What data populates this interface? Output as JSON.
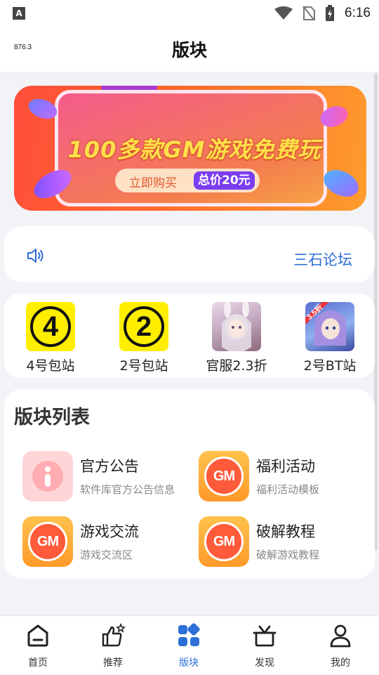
{
  "status_bar": {
    "time": "6:16",
    "left_icon": "A"
  },
  "header": {
    "speed": "876.3",
    "title": "版块"
  },
  "banner": {
    "headline": "100多款GM游戏免费玩",
    "buy_label": "立即购买",
    "price_label": "总价20元"
  },
  "notice": {
    "text": "三石论坛"
  },
  "quick_links": [
    {
      "label": "4号包站",
      "number": "4"
    },
    {
      "label": "2号包站",
      "number": "2"
    },
    {
      "label": "官服2.3折"
    },
    {
      "label": "2号BT站",
      "badge": "3.5折"
    }
  ],
  "section": {
    "heading": "版块列表",
    "boards": [
      {
        "name": "官方公告",
        "desc": "软件库官方公告信息",
        "icon": "info-icon"
      },
      {
        "name": "福利活动",
        "desc": "福利活动模板",
        "icon": "gm-icon",
        "icon_text": "GM"
      },
      {
        "name": "游戏交流",
        "desc": "游戏交流区",
        "icon": "gm-icon",
        "icon_text": "GM"
      },
      {
        "name": "破解教程",
        "desc": "破解游戏教程",
        "icon": "gm-icon",
        "icon_text": "GM"
      }
    ]
  },
  "tabbar": {
    "tabs": [
      {
        "label": "首页",
        "icon": "home-icon"
      },
      {
        "label": "推荐",
        "icon": "thumbs-up-icon"
      },
      {
        "label": "版块",
        "icon": "grid-icon",
        "active": true
      },
      {
        "label": "发现",
        "icon": "gift-icon"
      },
      {
        "label": "我的",
        "icon": "user-icon"
      }
    ]
  },
  "colors": {
    "accent": "#2d6fd6",
    "background": "#f2f3f7"
  }
}
